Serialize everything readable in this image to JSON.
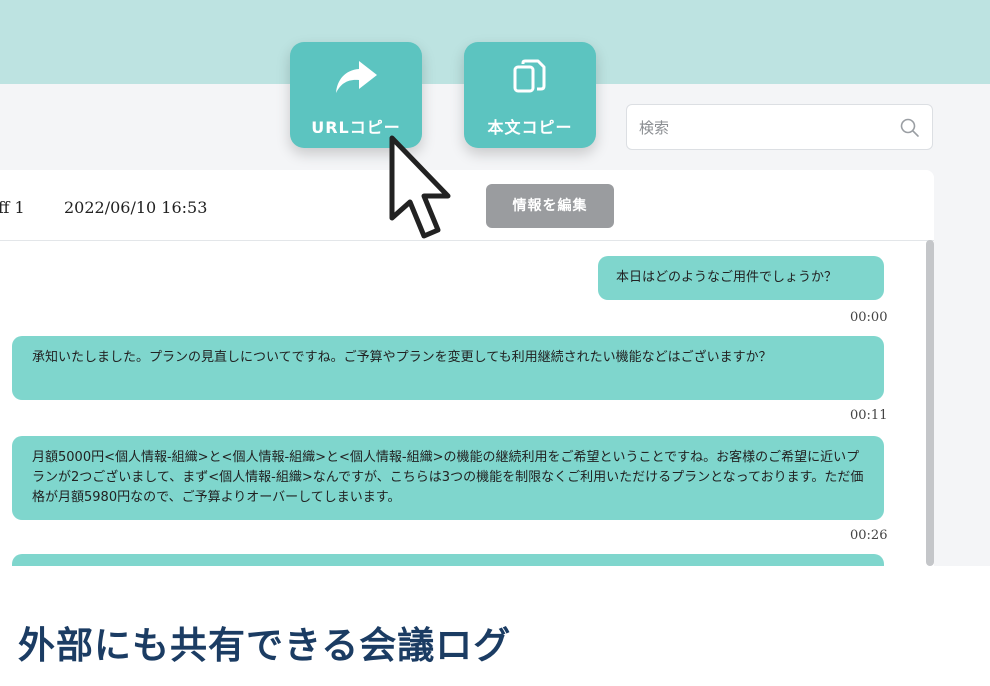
{
  "toolbar": {
    "url_copy_label": "URLコピー",
    "text_copy_label": "本文コピー"
  },
  "search": {
    "placeholder": "検索"
  },
  "record": {
    "author": "ff 1",
    "datetime": "2022/06/10 16:53",
    "edit_label": "情報を編集"
  },
  "messages": [
    {
      "text": "本日はどのようなご用件でしょうか？",
      "time": "00:00"
    },
    {
      "text": "承知いたしました。プランの見直しについてですね。ご予算やプランを変更しても利用継続されたい機能などはございますか？",
      "time": "00:11"
    },
    {
      "text": "月額5000円<個人情報-組織>と<個人情報-組織>と<個人情報-組織>の機能の継続利用をご希望ということですね。お客様のご希望に近いプランが2つございまして、まず<個人情報-組織>なんですが、こちらは3つの機能を制限なくご利用いただけるプランとなっております。ただ価格が月額5980円なので、ご予算よりオーバーしてしまいます。",
      "time": "00:26"
    }
  ],
  "footer": {
    "heading": "外部にも共有できる会議ログ"
  },
  "colors": {
    "banner": "#bde3e1",
    "button": "#5cc4c0",
    "bubble": "#7fd6cd",
    "heading": "#1b3c63",
    "edit_button": "#9a9c9f"
  },
  "icons": {
    "url_copy": "share-arrow-icon",
    "text_copy": "copy-icon",
    "search": "search-icon",
    "cursor": "mouse-pointer-icon"
  }
}
